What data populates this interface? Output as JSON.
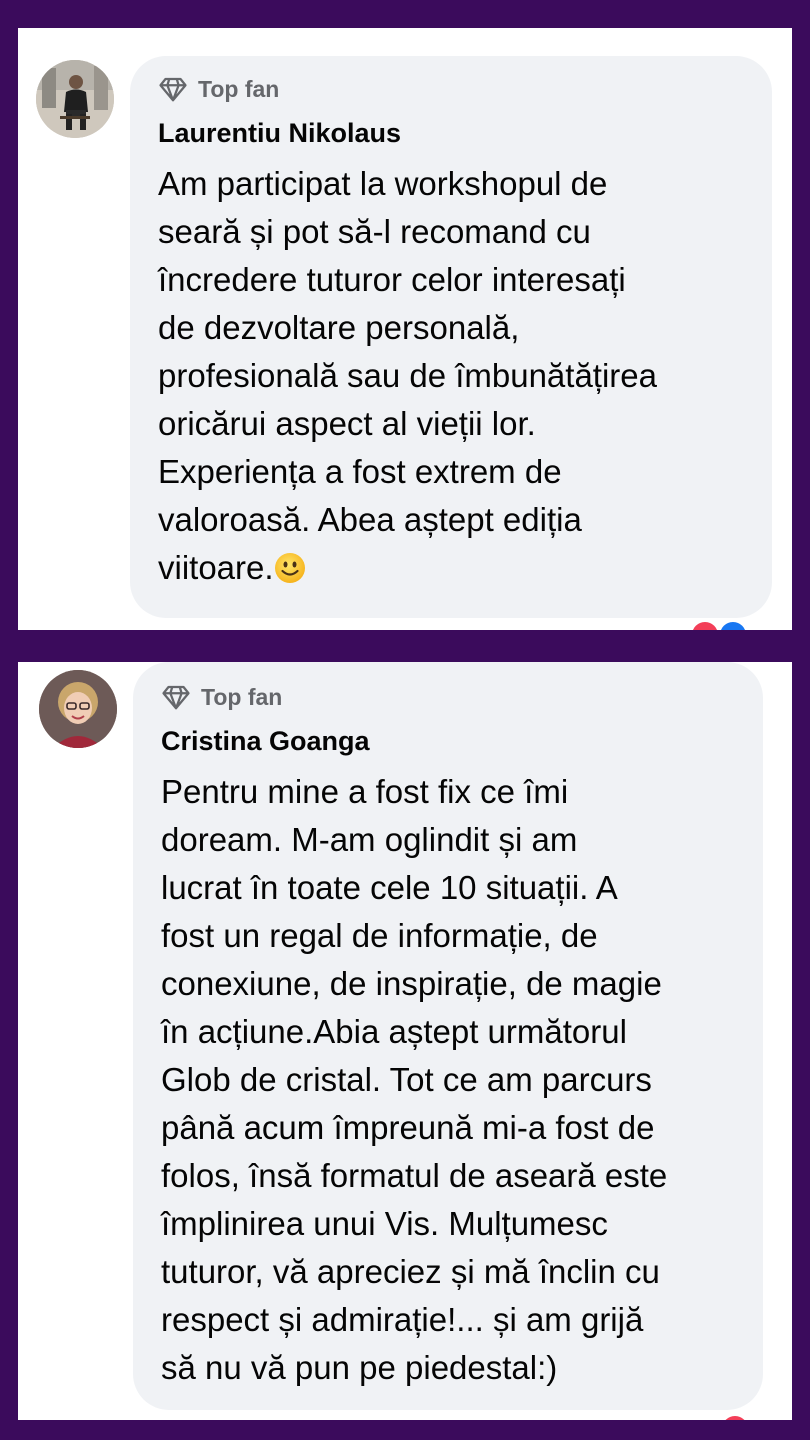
{
  "comments": [
    {
      "badge": "Top fan",
      "author": "Laurentiu Nikolaus",
      "text": "Am participat la workshopul de\nseară și pot să-l recomand cu\nîncredere tuturor celor interesați\nde dezvoltare personală,\nprofesională sau de îmbunătățirea\noricărui aspect al vieții lor.\nExperiența a fost extrem de\nvaloroasă. Abea aștept ediția\nviitoare.",
      "emoji": "smiling-face-emoji"
    },
    {
      "badge": "Top fan",
      "author": "Cristina Goanga",
      "text": "Pentru mine a fost fix ce îmi\ndoream. M-am oglindit și am\nlucrat în toate cele 10 situații. A\nfost un regal de informație, de\nconexiune, de inspirație, de magie\nîn acțiune.Abia aștept următorul\nGlob de cristal. Tot ce am parcurs\npână acum împreună mi-a fost de\nfolos, însă formatul de aseară este\nîmplinirea unui Vis. Mulțumesc\ntuturor, vă apreciez și mă înclin cu\nrespect și admirație!... și am grijă\nsă nu vă pun pe piedestal:)"
    }
  ],
  "colors": {
    "background": "#3b0b5c",
    "bubble": "#f0f2f5",
    "secondary_text": "#65676b",
    "primary_text": "#050505"
  },
  "icons": {
    "badge": "diamond-icon",
    "reactions": [
      "love-reaction-icon",
      "like-reaction-icon"
    ]
  }
}
